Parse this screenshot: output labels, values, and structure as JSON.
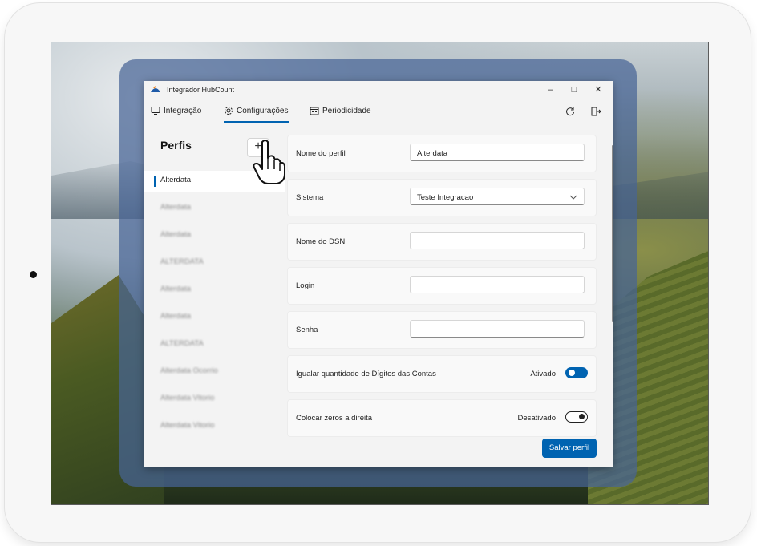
{
  "window": {
    "title": "Integrador HubCount"
  },
  "window_controls": {
    "minimize": "–",
    "maximize": "□",
    "close": "✕"
  },
  "nav": {
    "tabs": [
      {
        "label": "Integração",
        "icon": "monitor-icon"
      },
      {
        "label": "Configurações",
        "icon": "gear-icon",
        "active": true
      },
      {
        "label": "Periodicidade",
        "icon": "calendar-icon"
      }
    ],
    "right_icons": [
      "refresh-icon",
      "logout-icon"
    ]
  },
  "sidebar": {
    "title": "Perfis",
    "add_label": "+",
    "items": [
      {
        "label": "Alterdata",
        "selected": true
      },
      {
        "label": "Alterdata",
        "blurred": true
      },
      {
        "label": "Alterdata",
        "blurred": true
      },
      {
        "label": "ALTERDATA",
        "blurred": true
      },
      {
        "label": "Alterdata",
        "blurred": true
      },
      {
        "label": "Alterdata",
        "blurred": true
      },
      {
        "label": "ALTERDATA",
        "blurred": true
      },
      {
        "label": "Alterdata Ocorrio",
        "blurred": true
      },
      {
        "label": "Alterdata Vitorio",
        "blurred": true
      },
      {
        "label": "Alterdata Vitorio",
        "blurred": true
      }
    ]
  },
  "form": {
    "nome_perfil": {
      "label": "Nome do perfil",
      "value": "Alterdata"
    },
    "sistema": {
      "label": "Sistema",
      "value": "Teste Integracao"
    },
    "nome_dsn": {
      "label": "Nome do DSN",
      "value": ""
    },
    "login": {
      "label": "Login",
      "value": ""
    },
    "senha": {
      "label": "Senha",
      "value": ""
    },
    "igualar_digitos": {
      "label": "Igualar quantidade de Dígitos das Contas",
      "state": "Ativado",
      "on": true
    },
    "zeros_direita": {
      "label": "Colocar zeros a direita",
      "state": "Desativado",
      "on": false
    }
  },
  "save_button": {
    "label": "Salvar perfil"
  },
  "colors": {
    "accent": "#0063b1",
    "backdrop": "#4664a0"
  }
}
